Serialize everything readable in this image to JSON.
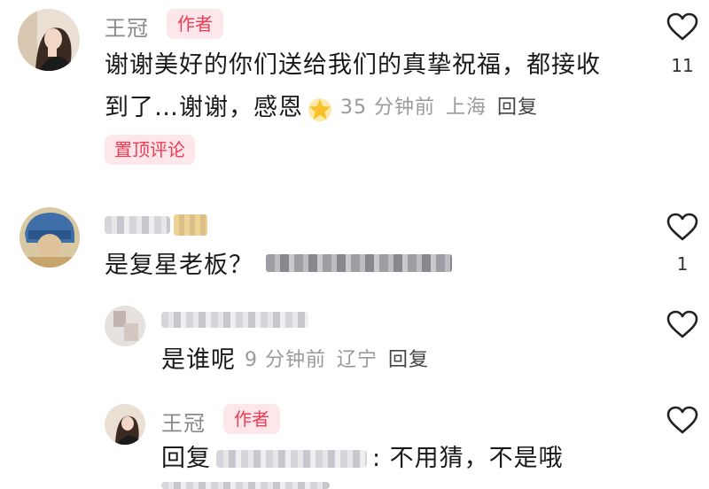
{
  "comments": [
    {
      "username": "王冠",
      "badge": "作者",
      "text_line1": "谢谢美好的你们送给我们的真挚祝福，都接收",
      "text_line2": "到了…谢谢，感恩",
      "emoji": "star-emoji",
      "time": "35 分钟前",
      "location": "上海",
      "reply": "回复",
      "pin": "置顶评论",
      "likes": "11"
    },
    {
      "text": "是复星老板？",
      "likes": "1"
    }
  ],
  "replies": [
    {
      "text": "是谁呢",
      "time": "9 分钟前",
      "location": "辽宁",
      "reply": "回复"
    },
    {
      "username": "王冠",
      "badge": "作者",
      "reply_prefix": "回复",
      "text": ": 不用猜，不是哦"
    }
  ],
  "icons": {
    "like": "heart-outline-icon"
  },
  "colors": {
    "accent": "#f23a52",
    "badge_bg": "#fde7ea",
    "muted": "#9a9a9a"
  }
}
